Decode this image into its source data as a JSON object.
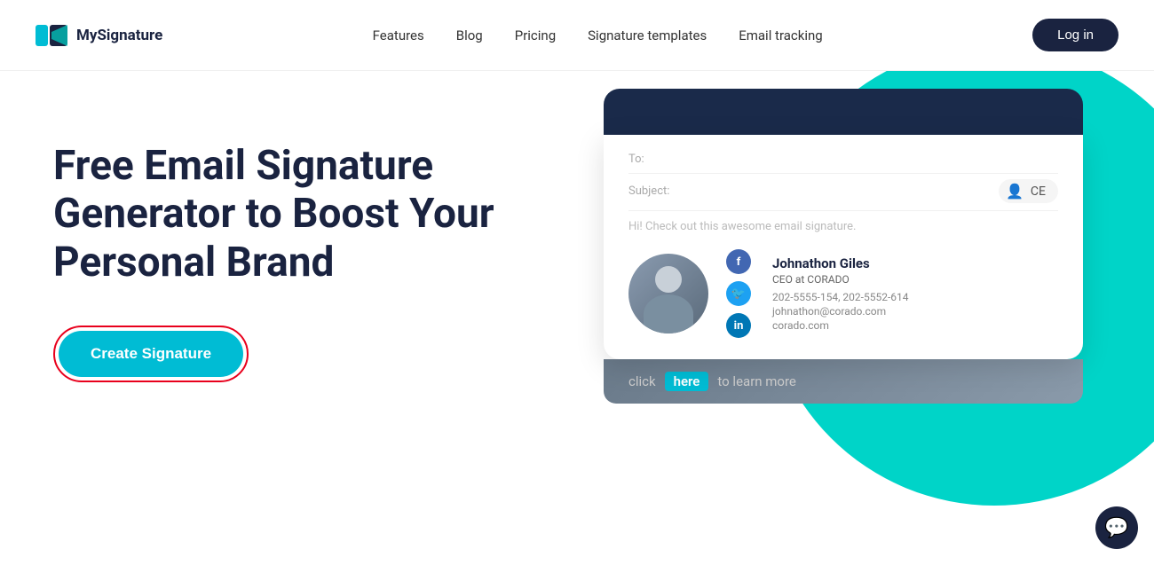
{
  "header": {
    "logo_text": "MySignature",
    "nav": [
      {
        "label": "Features",
        "id": "features"
      },
      {
        "label": "Blog",
        "id": "blog"
      },
      {
        "label": "Pricing",
        "id": "pricing"
      },
      {
        "label": "Signature templates",
        "id": "signature-templates"
      },
      {
        "label": "Email tracking",
        "id": "email-tracking"
      }
    ],
    "login_label": "Log in"
  },
  "hero": {
    "title": "Free Email Signature Generator to Boost Your Personal Brand",
    "cta_label": "Create Signature"
  },
  "email_mockup": {
    "to_label": "To:",
    "subject_label": "Subject:",
    "avatar_label": "CE",
    "body_text": "Hi! Check out this awesome email signature.",
    "signature": {
      "name": "Johnathon Giles",
      "title": "CEO at CORADO",
      "phone1": "202-5555-154, 202-5552-614",
      "email": "johnathon@corado.com",
      "website": "corado.com"
    },
    "cta_bar": {
      "text1": "click",
      "here": "here",
      "text2": "to learn more"
    }
  },
  "chat": {
    "icon": "💬"
  }
}
